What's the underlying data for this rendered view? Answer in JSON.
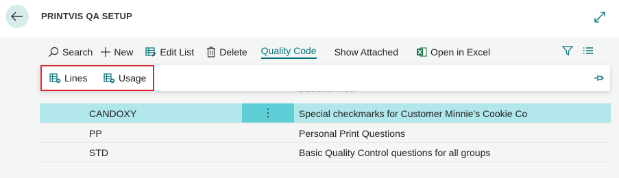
{
  "header": {
    "title": "PRINTVIS QA SETUP"
  },
  "actions": {
    "search": "Search",
    "new": "New",
    "edit_list": "Edit List",
    "delete": "Delete",
    "quality_code": "Quality Code",
    "show_attached": "Show Attached",
    "open_in_excel": "Open in Excel"
  },
  "subactions": {
    "lines": "Lines",
    "usage": "Usage"
  },
  "table": {
    "description_header": "DESCRIPTION",
    "rows": [
      {
        "code": "CANDOXY",
        "description": "Special checkmarks for Customer Minnie's Cookie Co",
        "selected": true
      },
      {
        "code": "PP",
        "description": "Personal Print Questions",
        "selected": false
      },
      {
        "code": "STD",
        "description": "Basic Quality Control questions for all groups",
        "selected": false
      }
    ]
  },
  "colors": {
    "accent": "#00707a",
    "selected_row": "#b1e6ea",
    "row_menu": "#5ecfd6",
    "highlight_border": "#d9262b",
    "excel_green": "#1e7145"
  },
  "icons": [
    "back-arrow-icon",
    "expand-icon",
    "search-icon",
    "plus-icon",
    "edit-list-icon",
    "trash-icon",
    "excel-icon",
    "filter-icon",
    "list-view-icon",
    "lines-icon",
    "usage-icon",
    "pin-icon",
    "more-vertical-icon"
  ]
}
